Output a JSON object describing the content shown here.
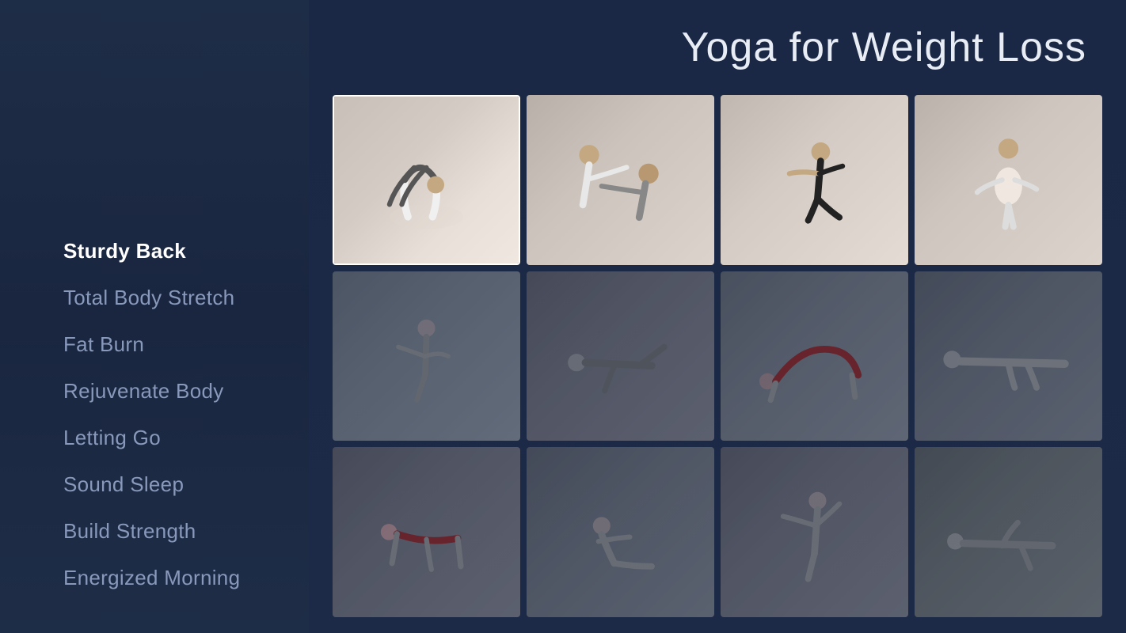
{
  "sidebar": {
    "items": [
      {
        "id": "sturdy-back",
        "label": "Sturdy Back",
        "active": true
      },
      {
        "id": "total-body-stretch",
        "label": "Total Body Stretch",
        "active": false
      },
      {
        "id": "fat-burn",
        "label": "Fat Burn",
        "active": false
      },
      {
        "id": "rejuvenate-body",
        "label": "Rejuvenate Body",
        "active": false
      },
      {
        "id": "letting-go",
        "label": "Letting Go",
        "active": false
      },
      {
        "id": "sound-sleep",
        "label": "Sound Sleep",
        "active": false
      },
      {
        "id": "build-strength",
        "label": "Build Strength",
        "active": false
      },
      {
        "id": "energized-morning",
        "label": "Energized Morning",
        "active": false
      }
    ]
  },
  "header": {
    "title": "Yoga for Weight Loss"
  },
  "grid": {
    "rows": [
      [
        {
          "id": "r1c1",
          "active": true,
          "dimmed": false,
          "alt": "Backbend pose"
        },
        {
          "id": "r1c2",
          "active": false,
          "dimmed": false,
          "alt": "Partner stretch pose"
        },
        {
          "id": "r1c3",
          "active": false,
          "dimmed": false,
          "alt": "Lunge pose"
        },
        {
          "id": "r1c4",
          "active": false,
          "dimmed": false,
          "alt": "Standing pose"
        }
      ],
      [
        {
          "id": "r2c1",
          "active": false,
          "dimmed": true,
          "alt": "Standing balance pose"
        },
        {
          "id": "r2c2",
          "active": false,
          "dimmed": true,
          "alt": "Lying pose"
        },
        {
          "id": "r2c3",
          "active": false,
          "dimmed": true,
          "alt": "Bridge pose"
        },
        {
          "id": "r2c4",
          "active": false,
          "dimmed": true,
          "alt": "Savasana pose"
        }
      ],
      [
        {
          "id": "r3c1",
          "active": false,
          "dimmed": true,
          "alt": "Cat cow pose"
        },
        {
          "id": "r3c2",
          "active": false,
          "dimmed": true,
          "alt": "Seated pose"
        },
        {
          "id": "r3c3",
          "active": false,
          "dimmed": true,
          "alt": "Side stretch pose"
        },
        {
          "id": "r3c4",
          "active": false,
          "dimmed": true,
          "alt": "Reclined pose"
        }
      ]
    ]
  }
}
